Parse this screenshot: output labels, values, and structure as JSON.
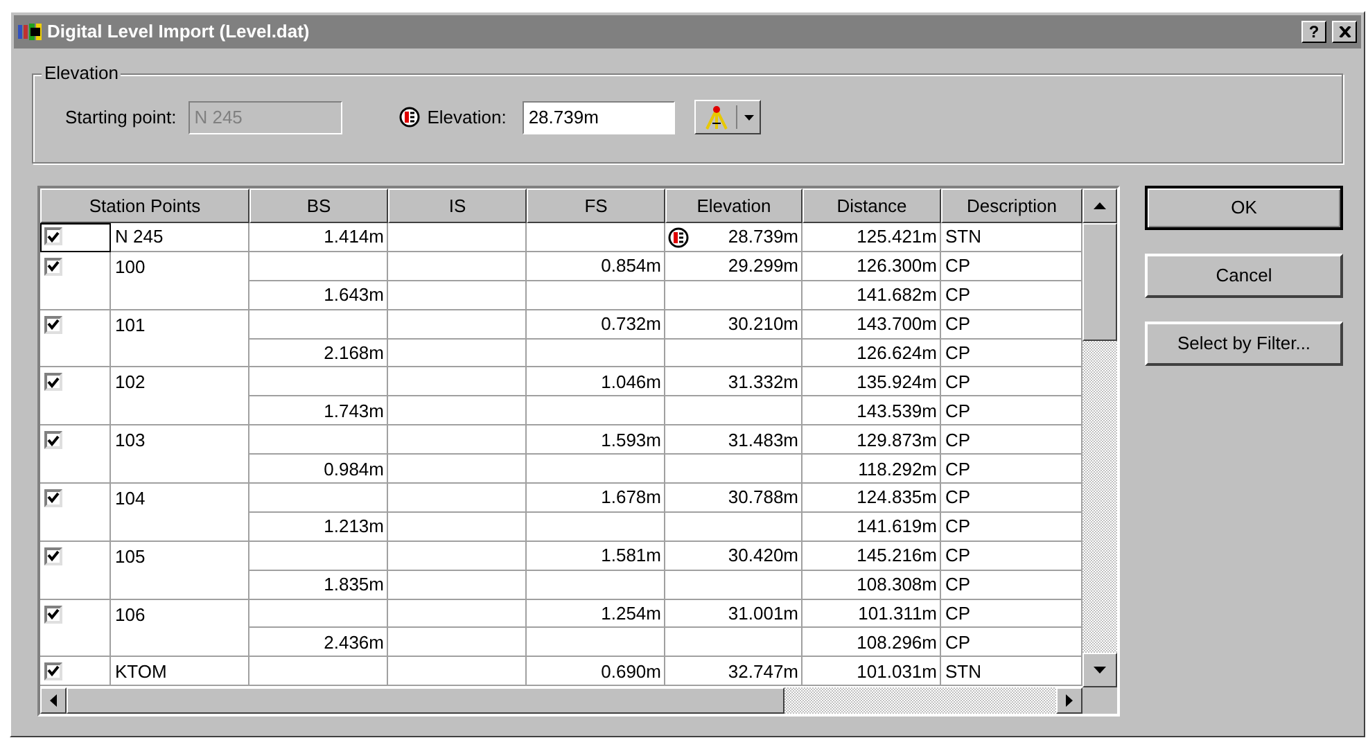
{
  "window": {
    "title": "Digital Level Import (Level.dat)",
    "help_button": "?"
  },
  "elevation_group": {
    "legend": "Elevation",
    "starting_point_label": "Starting point:",
    "starting_point": {
      "value": "N 245",
      "disabled": true
    },
    "elevation_label": "Elevation:",
    "elevation_value": "28.739m"
  },
  "table": {
    "columns": [
      "Station Points",
      "BS",
      "IS",
      "FS",
      "Elevation",
      "Distance",
      "Description"
    ],
    "rows": [
      {
        "kind": "station",
        "checked": true,
        "focused": true,
        "start": true,
        "name": "N 245",
        "bs": "1.414m",
        "fs": "",
        "elevation": "28.739m",
        "distance": "125.421m",
        "description": "STN"
      },
      {
        "kind": "station",
        "checked": true,
        "focused": false,
        "start": false,
        "name": "100",
        "bs": "",
        "fs": "0.854m",
        "elevation": "29.299m",
        "distance": "126.300m",
        "description": "CP"
      },
      {
        "kind": "reading",
        "bs": "1.643m",
        "distance": "141.682m",
        "description": "CP"
      },
      {
        "kind": "station",
        "checked": true,
        "focused": false,
        "start": false,
        "name": "101",
        "bs": "",
        "fs": "0.732m",
        "elevation": "30.210m",
        "distance": "143.700m",
        "description": "CP"
      },
      {
        "kind": "reading",
        "bs": "2.168m",
        "distance": "126.624m",
        "description": "CP"
      },
      {
        "kind": "station",
        "checked": true,
        "focused": false,
        "start": false,
        "name": "102",
        "bs": "",
        "fs": "1.046m",
        "elevation": "31.332m",
        "distance": "135.924m",
        "description": "CP"
      },
      {
        "kind": "reading",
        "bs": "1.743m",
        "distance": "143.539m",
        "description": "CP"
      },
      {
        "kind": "station",
        "checked": true,
        "focused": false,
        "start": false,
        "name": "103",
        "bs": "",
        "fs": "1.593m",
        "elevation": "31.483m",
        "distance": "129.873m",
        "description": "CP"
      },
      {
        "kind": "reading",
        "bs": "0.984m",
        "distance": "118.292m",
        "description": "CP"
      },
      {
        "kind": "station",
        "checked": true,
        "focused": false,
        "start": false,
        "name": "104",
        "bs": "",
        "fs": "1.678m",
        "elevation": "30.788m",
        "distance": "124.835m",
        "description": "CP"
      },
      {
        "kind": "reading",
        "bs": "1.213m",
        "distance": "141.619m",
        "description": "CP"
      },
      {
        "kind": "station",
        "checked": true,
        "focused": false,
        "start": false,
        "name": "105",
        "bs": "",
        "fs": "1.581m",
        "elevation": "30.420m",
        "distance": "145.216m",
        "description": "CP"
      },
      {
        "kind": "reading",
        "bs": "1.835m",
        "distance": "108.308m",
        "description": "CP"
      },
      {
        "kind": "station",
        "checked": true,
        "focused": false,
        "start": false,
        "name": "106",
        "bs": "",
        "fs": "1.254m",
        "elevation": "31.001m",
        "distance": "101.311m",
        "description": "CP"
      },
      {
        "kind": "reading",
        "bs": "2.436m",
        "distance": "108.296m",
        "description": "CP"
      },
      {
        "kind": "station",
        "checked": true,
        "focused": false,
        "start": false,
        "name": "KTOM",
        "bs": "",
        "fs": "0.690m",
        "elevation": "32.747m",
        "distance": "101.031m",
        "description": "STN"
      }
    ]
  },
  "buttons": [
    {
      "label": "OK",
      "default": true
    },
    {
      "label": "Cancel",
      "default": false
    },
    {
      "label": "Select by Filter...",
      "default": false
    }
  ]
}
